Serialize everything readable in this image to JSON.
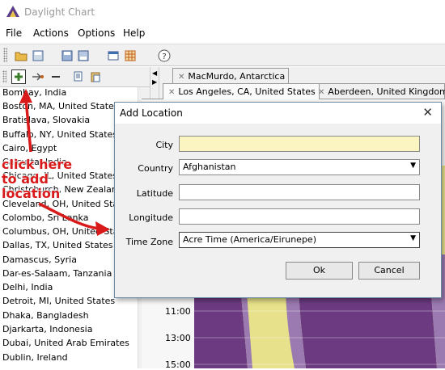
{
  "window": {
    "title": "Daylight Chart"
  },
  "menu": [
    "File",
    "Actions",
    "Options",
    "Help"
  ],
  "tabs": [
    "MacMurdo, Antarctica",
    "Los Angeles, CA, United States",
    "Aberdeen, United Kingdom"
  ],
  "locations": [
    "Bombay, India",
    "Boston, MA, United States",
    "Bratislava, Slovakia",
    "Buffalo, NY, United States",
    "Cairo, Egypt",
    "Calcutta, India",
    "Chicago, IL, United States",
    "Christchurch, New Zealand",
    "Cleveland, OH, United States",
    "Colombo, Sri Lanka",
    "Columbus, OH, United States",
    "Dallas, TX, United States",
    "Damascus, Syria",
    "Dar-es-Salaam, Tanzania",
    "Delhi, India",
    "Detroit, MI, United States",
    "Dhaka, Bangladesh",
    "Djarkarta, Indonesia",
    "Dubai, United Arab Emirates",
    "Dublin, Ireland"
  ],
  "dialog": {
    "title": "Add Location",
    "labels": {
      "city": "City",
      "country": "Country",
      "latitude": "Latitude",
      "longitude": "Longitude",
      "timezone": "Time Zone"
    },
    "values": {
      "city": "",
      "country": "Afghanistan",
      "latitude": "",
      "longitude": "",
      "timezone": "Acre Time (America/Eirunepe)"
    },
    "ok": "Ok",
    "cancel": "Cancel"
  },
  "chart": {
    "y_ticks": [
      "11:00",
      "13:00",
      "15:00"
    ]
  },
  "annotation": {
    "line1": "click here",
    "line2": "to add",
    "line3": "location"
  },
  "colors": {
    "daylight": "#e6e18a",
    "night": "#6b3a80",
    "twilight": "#9a7ab0",
    "annotation": "#d91a1a"
  }
}
